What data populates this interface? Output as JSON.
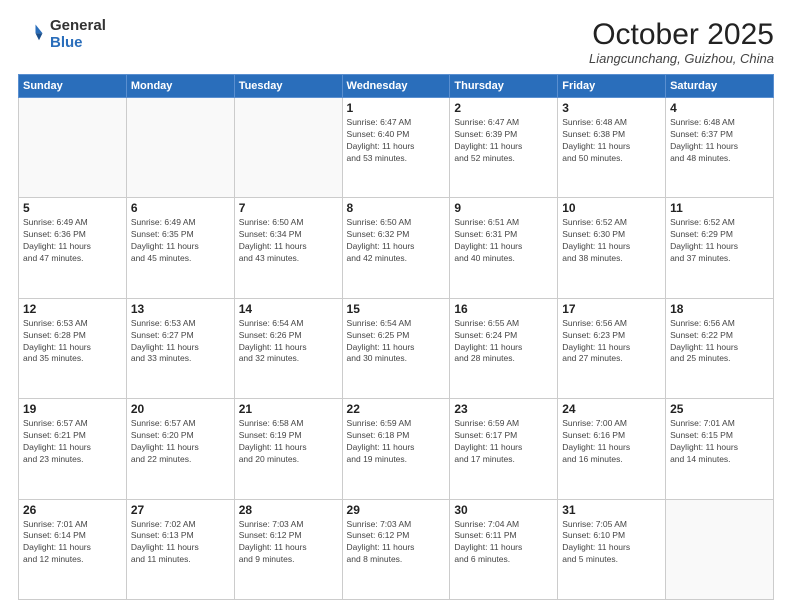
{
  "header": {
    "logo_general": "General",
    "logo_blue": "Blue",
    "month": "October 2025",
    "location": "Liangcunchang, Guizhou, China"
  },
  "weekdays": [
    "Sunday",
    "Monday",
    "Tuesday",
    "Wednesday",
    "Thursday",
    "Friday",
    "Saturday"
  ],
  "weeks": [
    [
      {
        "day": "",
        "info": ""
      },
      {
        "day": "",
        "info": ""
      },
      {
        "day": "",
        "info": ""
      },
      {
        "day": "1",
        "info": "Sunrise: 6:47 AM\nSunset: 6:40 PM\nDaylight: 11 hours\nand 53 minutes."
      },
      {
        "day": "2",
        "info": "Sunrise: 6:47 AM\nSunset: 6:39 PM\nDaylight: 11 hours\nand 52 minutes."
      },
      {
        "day": "3",
        "info": "Sunrise: 6:48 AM\nSunset: 6:38 PM\nDaylight: 11 hours\nand 50 minutes."
      },
      {
        "day": "4",
        "info": "Sunrise: 6:48 AM\nSunset: 6:37 PM\nDaylight: 11 hours\nand 48 minutes."
      }
    ],
    [
      {
        "day": "5",
        "info": "Sunrise: 6:49 AM\nSunset: 6:36 PM\nDaylight: 11 hours\nand 47 minutes."
      },
      {
        "day": "6",
        "info": "Sunrise: 6:49 AM\nSunset: 6:35 PM\nDaylight: 11 hours\nand 45 minutes."
      },
      {
        "day": "7",
        "info": "Sunrise: 6:50 AM\nSunset: 6:34 PM\nDaylight: 11 hours\nand 43 minutes."
      },
      {
        "day": "8",
        "info": "Sunrise: 6:50 AM\nSunset: 6:32 PM\nDaylight: 11 hours\nand 42 minutes."
      },
      {
        "day": "9",
        "info": "Sunrise: 6:51 AM\nSunset: 6:31 PM\nDaylight: 11 hours\nand 40 minutes."
      },
      {
        "day": "10",
        "info": "Sunrise: 6:52 AM\nSunset: 6:30 PM\nDaylight: 11 hours\nand 38 minutes."
      },
      {
        "day": "11",
        "info": "Sunrise: 6:52 AM\nSunset: 6:29 PM\nDaylight: 11 hours\nand 37 minutes."
      }
    ],
    [
      {
        "day": "12",
        "info": "Sunrise: 6:53 AM\nSunset: 6:28 PM\nDaylight: 11 hours\nand 35 minutes."
      },
      {
        "day": "13",
        "info": "Sunrise: 6:53 AM\nSunset: 6:27 PM\nDaylight: 11 hours\nand 33 minutes."
      },
      {
        "day": "14",
        "info": "Sunrise: 6:54 AM\nSunset: 6:26 PM\nDaylight: 11 hours\nand 32 minutes."
      },
      {
        "day": "15",
        "info": "Sunrise: 6:54 AM\nSunset: 6:25 PM\nDaylight: 11 hours\nand 30 minutes."
      },
      {
        "day": "16",
        "info": "Sunrise: 6:55 AM\nSunset: 6:24 PM\nDaylight: 11 hours\nand 28 minutes."
      },
      {
        "day": "17",
        "info": "Sunrise: 6:56 AM\nSunset: 6:23 PM\nDaylight: 11 hours\nand 27 minutes."
      },
      {
        "day": "18",
        "info": "Sunrise: 6:56 AM\nSunset: 6:22 PM\nDaylight: 11 hours\nand 25 minutes."
      }
    ],
    [
      {
        "day": "19",
        "info": "Sunrise: 6:57 AM\nSunset: 6:21 PM\nDaylight: 11 hours\nand 23 minutes."
      },
      {
        "day": "20",
        "info": "Sunrise: 6:57 AM\nSunset: 6:20 PM\nDaylight: 11 hours\nand 22 minutes."
      },
      {
        "day": "21",
        "info": "Sunrise: 6:58 AM\nSunset: 6:19 PM\nDaylight: 11 hours\nand 20 minutes."
      },
      {
        "day": "22",
        "info": "Sunrise: 6:59 AM\nSunset: 6:18 PM\nDaylight: 11 hours\nand 19 minutes."
      },
      {
        "day": "23",
        "info": "Sunrise: 6:59 AM\nSunset: 6:17 PM\nDaylight: 11 hours\nand 17 minutes."
      },
      {
        "day": "24",
        "info": "Sunrise: 7:00 AM\nSunset: 6:16 PM\nDaylight: 11 hours\nand 16 minutes."
      },
      {
        "day": "25",
        "info": "Sunrise: 7:01 AM\nSunset: 6:15 PM\nDaylight: 11 hours\nand 14 minutes."
      }
    ],
    [
      {
        "day": "26",
        "info": "Sunrise: 7:01 AM\nSunset: 6:14 PM\nDaylight: 11 hours\nand 12 minutes."
      },
      {
        "day": "27",
        "info": "Sunrise: 7:02 AM\nSunset: 6:13 PM\nDaylight: 11 hours\nand 11 minutes."
      },
      {
        "day": "28",
        "info": "Sunrise: 7:03 AM\nSunset: 6:12 PM\nDaylight: 11 hours\nand 9 minutes."
      },
      {
        "day": "29",
        "info": "Sunrise: 7:03 AM\nSunset: 6:12 PM\nDaylight: 11 hours\nand 8 minutes."
      },
      {
        "day": "30",
        "info": "Sunrise: 7:04 AM\nSunset: 6:11 PM\nDaylight: 11 hours\nand 6 minutes."
      },
      {
        "day": "31",
        "info": "Sunrise: 7:05 AM\nSunset: 6:10 PM\nDaylight: 11 hours\nand 5 minutes."
      },
      {
        "day": "",
        "info": ""
      }
    ]
  ]
}
